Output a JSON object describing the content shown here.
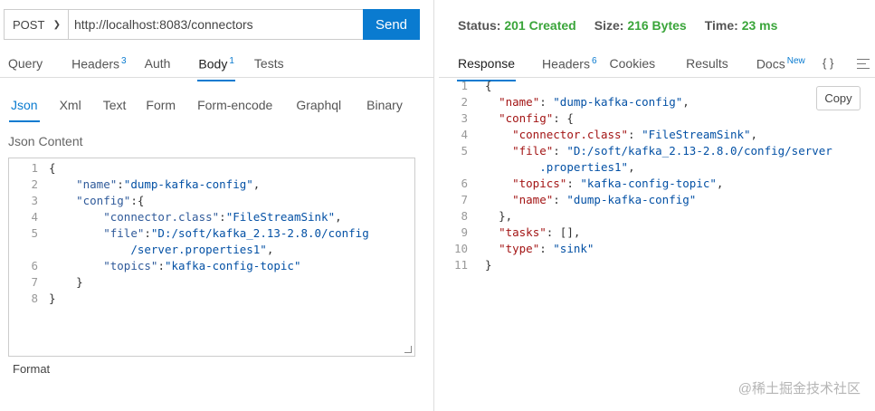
{
  "request": {
    "method": "POST",
    "url": "http://localhost:8083/connectors",
    "send_label": "Send",
    "tabs": [
      {
        "label": "Query",
        "badge": ""
      },
      {
        "label": "Headers",
        "badge": "3"
      },
      {
        "label": "Auth",
        "badge": ""
      },
      {
        "label": "Body",
        "badge": "1"
      },
      {
        "label": "Tests",
        "badge": ""
      }
    ],
    "body_tabs": [
      "Json",
      "Xml",
      "Text",
      "Form",
      "Form-encode",
      "Graphql",
      "Binary"
    ],
    "content_label": "Json Content",
    "format_label": "Format",
    "line_numbers": [
      "1",
      "2",
      "3",
      "4",
      "5",
      "",
      "6",
      "7",
      "8"
    ],
    "lines": [
      [
        "{"
      ],
      [
        "    ",
        "\"name\"",
        ":",
        "\"dump-kafka-config\"",
        ","
      ],
      [
        "    ",
        "\"config\"",
        ":{"
      ],
      [
        "        ",
        "\"connector.class\"",
        ":",
        "\"FileStreamSink\"",
        ","
      ],
      [
        "        ",
        "\"file\"",
        ":",
        "\"D:/soft/kafka_2.13-2.8.0/config"
      ],
      [
        "            ",
        "/server.properties1\"",
        ","
      ],
      [
        "        ",
        "\"topics\"",
        ":",
        "\"kafka-config-topic\""
      ],
      [
        "    ",
        "}"
      ],
      [
        "}"
      ]
    ]
  },
  "response": {
    "status_label": "Status:",
    "status_value": "201 Created",
    "size_label": "Size:",
    "size_value": "216 Bytes",
    "time_label": "Time:",
    "time_value": "23 ms",
    "tabs": [
      {
        "label": "Response",
        "badge": ""
      },
      {
        "label": "Headers",
        "badge": "6"
      },
      {
        "label": "Cookies",
        "badge": ""
      },
      {
        "label": "Results",
        "badge": ""
      },
      {
        "label": "Docs",
        "badge": "New"
      }
    ],
    "braces_icon": "{ }",
    "copy_label": "Copy",
    "line_numbers": [
      "1",
      "2",
      "3",
      "4",
      "5",
      "",
      "6",
      "7",
      "8",
      "9",
      "10",
      "11"
    ],
    "lines": [
      [
        "{"
      ],
      [
        "  ",
        "\"name\"",
        ": ",
        "\"dump-kafka-config\"",
        ","
      ],
      [
        "  ",
        "\"config\"",
        ": {"
      ],
      [
        "    ",
        "\"connector.class\"",
        ": ",
        "\"FileStreamSink\"",
        ","
      ],
      [
        "    ",
        "\"file\"",
        ": ",
        "\"D:/soft/kafka_2.13-2.8.0/config/server"
      ],
      [
        "        ",
        ".properties1\"",
        ","
      ],
      [
        "    ",
        "\"topics\"",
        ": ",
        "\"kafka-config-topic\"",
        ","
      ],
      [
        "    ",
        "\"name\"",
        ": ",
        "\"dump-kafka-config\""
      ],
      [
        "  ",
        "},"
      ],
      [
        "  ",
        "\"tasks\"",
        ": [],"
      ],
      [
        "  ",
        "\"type\"",
        ": ",
        "\"sink\""
      ],
      [
        "}"
      ]
    ]
  },
  "watermark": "@稀土掘金技术社区"
}
